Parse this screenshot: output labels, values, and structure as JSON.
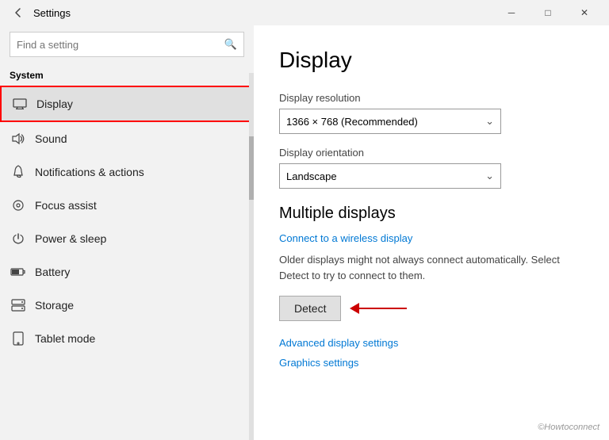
{
  "titlebar": {
    "back_icon": "←",
    "title": "Settings",
    "minimize_icon": "─",
    "maximize_icon": "□",
    "close_icon": "✕"
  },
  "sidebar": {
    "search_placeholder": "Find a setting",
    "search_icon": "🔍",
    "section_label": "System",
    "items": [
      {
        "id": "display",
        "label": "Display",
        "icon": "monitor",
        "active": true
      },
      {
        "id": "sound",
        "label": "Sound",
        "icon": "sound"
      },
      {
        "id": "notifications",
        "label": "Notifications & actions",
        "icon": "notifications"
      },
      {
        "id": "focus",
        "label": "Focus assist",
        "icon": "focus"
      },
      {
        "id": "power",
        "label": "Power & sleep",
        "icon": "power"
      },
      {
        "id": "battery",
        "label": "Battery",
        "icon": "battery"
      },
      {
        "id": "storage",
        "label": "Storage",
        "icon": "storage"
      },
      {
        "id": "tablet",
        "label": "Tablet mode",
        "icon": "tablet"
      }
    ]
  },
  "main": {
    "page_title": "Display",
    "resolution_label": "Display resolution",
    "resolution_value": "1366 × 768 (Recommended)",
    "orientation_label": "Display orientation",
    "orientation_value": "Landscape",
    "multiple_displays_heading": "Multiple displays",
    "wireless_link": "Connect to a wireless display",
    "detect_description": "Older displays might not always connect automatically. Select Detect to try to connect to them.",
    "detect_button": "Detect",
    "advanced_link": "Advanced display settings",
    "graphics_link": "Graphics settings"
  },
  "watermark": "©Howtoconnect"
}
